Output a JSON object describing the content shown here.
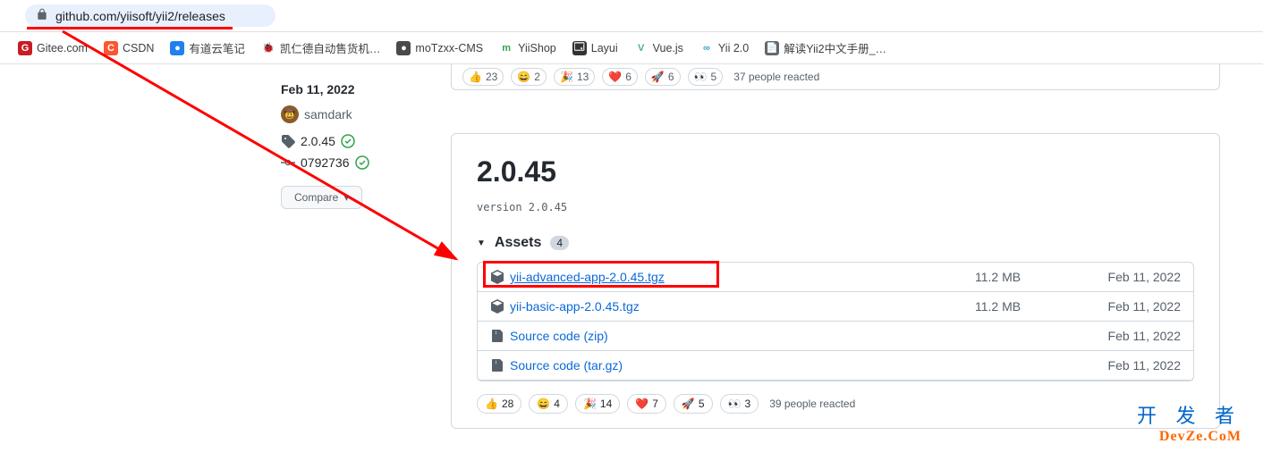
{
  "url": "github.com/yiisoft/yii2/releases",
  "bookmarks": [
    {
      "label": "Gitee.com",
      "iconChar": "G",
      "bg": "#c71d23"
    },
    {
      "label": "CSDN",
      "iconChar": "C",
      "bg": "#fc5531"
    },
    {
      "label": "有道云笔记",
      "iconChar": "●",
      "bg": "#2080f0"
    },
    {
      "label": "凯仁德自动售货机…",
      "iconChar": "🐞",
      "bg": "#333"
    },
    {
      "label": "moTzxx-CMS",
      "iconChar": "●",
      "bg": "#4a4a4a"
    },
    {
      "label": "YiiShop",
      "iconChar": "m",
      "bg": "#2ea44f"
    },
    {
      "label": "Layui",
      "iconChar": "🗔",
      "bg": "#333"
    },
    {
      "label": "Vue.js",
      "iconChar": "V",
      "bg": "#42b883"
    },
    {
      "label": "Yii 2.0",
      "iconChar": "∞",
      "bg": "#2aa1d8"
    },
    {
      "label": "解读Yii2中文手册_…",
      "iconChar": "📄",
      "bg": "#666"
    }
  ],
  "topReactions": {
    "items": [
      {
        "emoji": "👍",
        "count": 23
      },
      {
        "emoji": "😄",
        "count": 2
      },
      {
        "emoji": "🎉",
        "count": 13
      },
      {
        "emoji": "❤️",
        "count": 6
      },
      {
        "emoji": "🚀",
        "count": 6
      },
      {
        "emoji": "👀",
        "count": 5
      }
    ],
    "text": "37 people reacted"
  },
  "leftMeta": {
    "date": "Feb 11, 2022",
    "author": "samdark",
    "tag": "2.0.45",
    "commit": "0792736",
    "compare": "Compare"
  },
  "release": {
    "title": "2.0.45",
    "versionLine": "version 2.0.45",
    "assetsLabel": "Assets",
    "assetsCount": "4",
    "assets": [
      {
        "name": "yii-advanced-app-2.0.45.tgz",
        "size": "11.2 MB",
        "date": "Feb 11, 2022",
        "type": "package"
      },
      {
        "name": "yii-basic-app-2.0.45.tgz",
        "size": "11.2 MB",
        "date": "Feb 11, 2022",
        "type": "package"
      },
      {
        "name": "Source code (zip)",
        "size": "",
        "date": "Feb 11, 2022",
        "type": "source"
      },
      {
        "name": "Source code (tar.gz)",
        "size": "",
        "date": "Feb 11, 2022",
        "type": "source"
      }
    ]
  },
  "bottomReactions": {
    "items": [
      {
        "emoji": "👍",
        "count": 28
      },
      {
        "emoji": "😄",
        "count": 4
      },
      {
        "emoji": "🎉",
        "count": 14
      },
      {
        "emoji": "❤️",
        "count": 7
      },
      {
        "emoji": "🚀",
        "count": 5
      },
      {
        "emoji": "👀",
        "count": 3
      }
    ],
    "text": "39 people reacted"
  },
  "watermark": {
    "cn": "开 发 者",
    "en": "DevZe.CoM"
  }
}
